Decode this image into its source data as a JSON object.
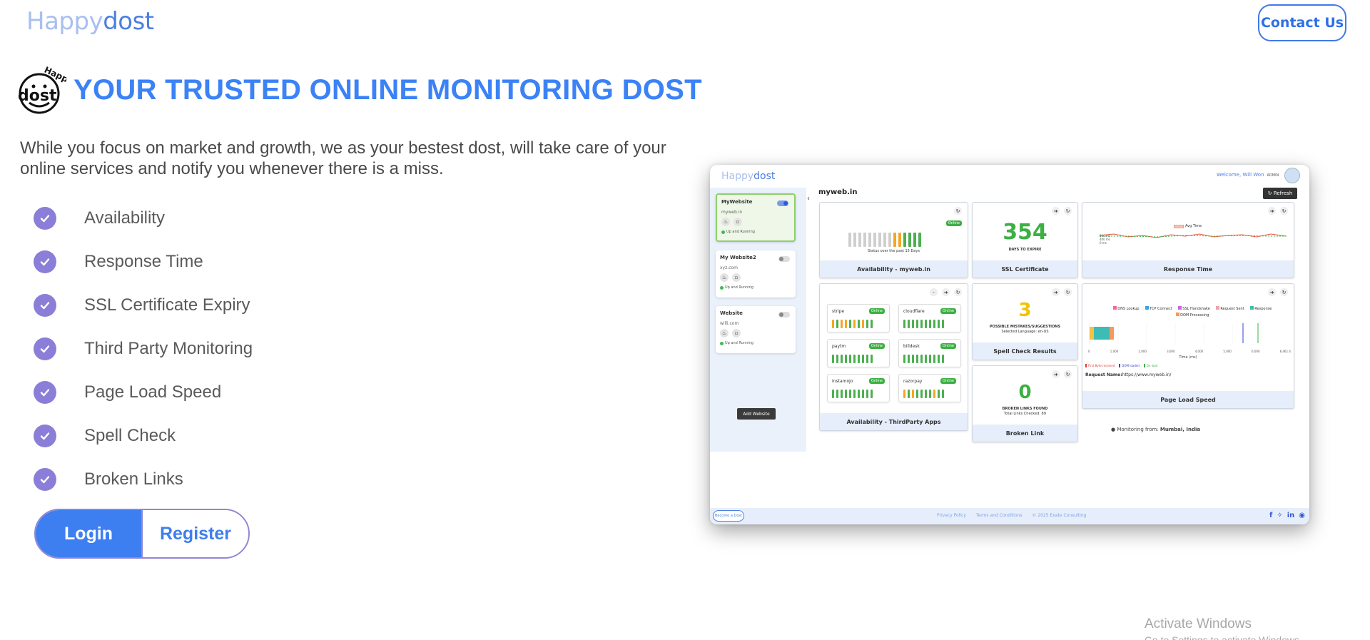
{
  "header": {
    "brand_part1": "Happy",
    "brand_part2": "dost",
    "contact_label": "Contact Us"
  },
  "hero": {
    "logo_text_top": "Happy",
    "logo_text_main": "dost",
    "title": "YOUR TRUSTED ONLINE MONITORING DOST",
    "description": "While you focus on market and growth, we as your bestest dost, will take care of your online services and notify you whenever there is a miss."
  },
  "features": [
    "Availability",
    "Response Time",
    "SSL Certificate Expiry",
    "Third Party Monitoring",
    "Page Load Speed",
    "Spell Check",
    "Broken Links"
  ],
  "auth": {
    "login_label": "Login",
    "register_label": "Register"
  },
  "preview": {
    "brand_part1": "Happy",
    "brand_part2": "dost",
    "welcome": "Welcome, Will Won",
    "welcome_small": "ADMIN",
    "domain": "myweb.in",
    "refresh_label": "Refresh",
    "sites": [
      {
        "name": "MyWebsite",
        "url": "myweb.in",
        "status": "Up and Running"
      },
      {
        "name": "My Website2",
        "url": "xyz.com",
        "status": "Up and Running"
      },
      {
        "name": "Website",
        "url": "willi.com",
        "status": "Up and Running"
      }
    ],
    "add_website": "Add Website",
    "availability": {
      "footer": "Availability - myweb.in",
      "status": "Online",
      "caption": "Status over the past 15 Days"
    },
    "ssl": {
      "value": "354",
      "caption": "DAYS TO EXPIRE",
      "footer": "SSL Certificate"
    },
    "response": {
      "footer": "Response Time",
      "legend": "Avg Time",
      "ticks": [
        "800 ms",
        "400 ms",
        "0 ms"
      ]
    },
    "third_party": {
      "footer": "Availability - ThirdParty Apps",
      "apps": [
        {
          "name": "stripe",
          "status": "Online"
        },
        {
          "name": "cloudflare",
          "status": "Online"
        },
        {
          "name": "paytm",
          "status": "Online"
        },
        {
          "name": "billdesk",
          "status": "Online"
        },
        {
          "name": "instamojo",
          "status": "Online"
        },
        {
          "name": "razorpay",
          "status": "Online"
        }
      ]
    },
    "spell": {
      "value": "3",
      "caption": "POSSIBLE MISTAKES/SUGGESTIONS",
      "sub": "Selected Language: en-US",
      "footer": "Spell Check Results"
    },
    "broken": {
      "value": "0",
      "caption": "BROKEN LINKS FOUND",
      "sub": "Total Links Checked: 89",
      "footer": "Broken Link"
    },
    "page_load": {
      "footer": "Page Load Speed",
      "legend": [
        "DNS Lookup",
        "TCP Connect",
        "SSL Handshake",
        "Request Sent",
        "Response",
        "DOM Processing"
      ],
      "axis_label": "Time (ms)",
      "ticks": [
        "0",
        "1,000",
        "2,000",
        "3,000",
        "4,000",
        "5,000",
        "6,000",
        "6,461.4"
      ],
      "markers": [
        "First Byte received",
        "DOM loaded",
        "On load"
      ],
      "request_label": "Request Name:",
      "request_value": "https://www.myweb.in/"
    },
    "monitoring_from": "Monitoring from:",
    "monitoring_city": "Mumbai, India",
    "footer": {
      "become": "Become a Dost",
      "privacy": "Privacy Policy",
      "terms": "Terms and Conditions",
      "copyright": "© 2025 Exate Consulting"
    }
  },
  "watermark": {
    "line1": "Activate Windows",
    "line2": "Go to Settings to activate Windows."
  },
  "colors": {
    "primary": "#3b82f6",
    "check": "#8b7ed8",
    "brand_light": "#a9bff0",
    "brand_dark": "#4c7fe0"
  }
}
